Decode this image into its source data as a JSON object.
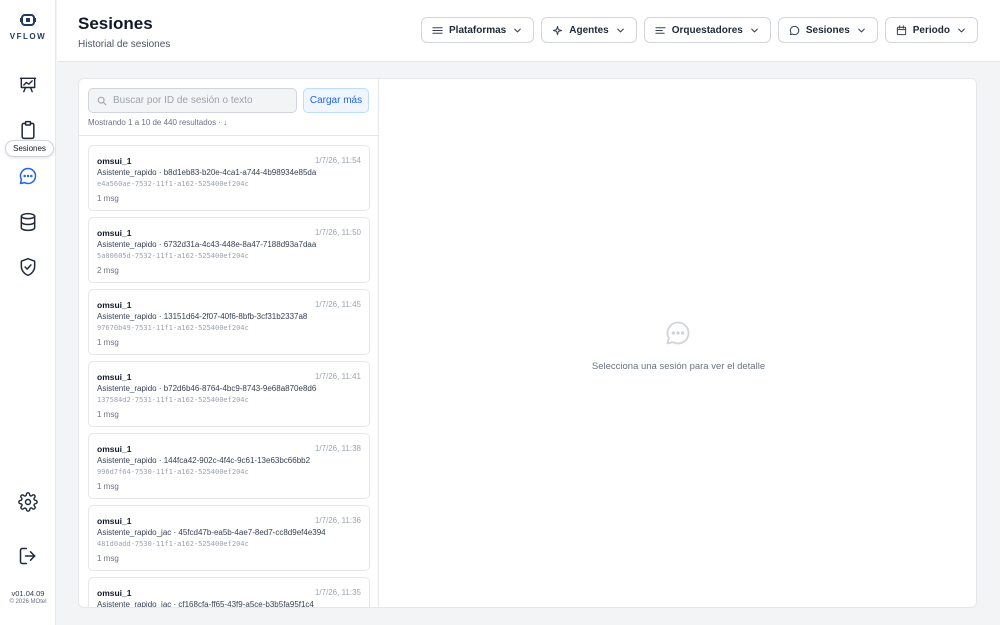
{
  "brand": {
    "logo_text": "VFLOW"
  },
  "sidebar": {
    "items": [
      {
        "name": "dashboard",
        "icon": "presentation-chart-icon"
      },
      {
        "name": "clipboard",
        "icon": "clipboard-icon"
      },
      {
        "name": "sesiones",
        "icon": "chat-bubble-icon",
        "active": true
      },
      {
        "name": "database",
        "icon": "database-icon"
      },
      {
        "name": "security",
        "icon": "shield-check-icon"
      }
    ],
    "tooltip": "Sesiones",
    "version": "v01.04.09",
    "copyright": "© 2026 MOtel"
  },
  "header": {
    "title": "Sesiones",
    "subtitle": "Historial de sesiones",
    "filters": [
      {
        "label": "Plataformas",
        "icon": "list-icon"
      },
      {
        "label": "Agentes",
        "icon": "sparkle-icon"
      },
      {
        "label": "Orquestadores",
        "icon": "lines-icon"
      },
      {
        "label": "Sesiones",
        "icon": "chat-bubble-icon"
      },
      {
        "label": "Periodo",
        "icon": "calendar-icon"
      }
    ]
  },
  "search": {
    "placeholder": "Buscar por ID de sesión o texto",
    "value": "",
    "load_more_label": "Cargar más",
    "results_text": "Mostrando 1 a 10 de 440 resultados · ↓"
  },
  "sessions": [
    {
      "user": "omsui_1",
      "time": "1/7/26, 11:54",
      "agent_line": "Asistente_rapido · b8d1eb83-b20e-4ca1-a744-4b98934e85da",
      "id": "e4a560ae-7532-11f1-a162-525400ef204c",
      "msgs": "1 msg"
    },
    {
      "user": "omsui_1",
      "time": "1/7/26, 11:50",
      "agent_line": "Asistente_rapido · 6732d31a-4c43-448e-8a47-7188d93a7daa",
      "id": "5a00605d-7532-11f1-a162-525400ef204c",
      "msgs": "2 msg"
    },
    {
      "user": "omsui_1",
      "time": "1/7/26, 11:45",
      "agent_line": "Asistente_rapido · 13151d64-2f07-40f6-8bfb-3cf31b2337a8",
      "id": "97670b49-7531-11f1-a162-525400ef204c",
      "msgs": "1 msg"
    },
    {
      "user": "omsui_1",
      "time": "1/7/26, 11:41",
      "agent_line": "Asistente_rapido · b72d6b46-8764-4bc9-8743-9e68a870e8d6",
      "id": "137584d2-7531-11f1-a162-525400ef204c",
      "msgs": "1 msg"
    },
    {
      "user": "omsui_1",
      "time": "1/7/26, 11:38",
      "agent_line": "Asistente_rapido · 144fca42-902c-4f4c-9c61-13e63bc66bb2",
      "id": "996d7f64-7530-11f1-a162-525400ef204c",
      "msgs": "1 msg"
    },
    {
      "user": "omsui_1",
      "time": "1/7/26, 11:36",
      "agent_line": "Asistente_rapido_jac · 45fcd47b-ea5b-4ae7-8ed7-cc8d9ef4e394",
      "id": "481d0add-7530-11f1-a162-525400ef204c",
      "msgs": "1 msg"
    },
    {
      "user": "omsui_1",
      "time": "1/7/26, 11:35",
      "agent_line": "Asistente_rapido_jac · cf168cfa-ff65-43f9-a5ce-b3b5fa95f1c4",
      "id": "",
      "msgs": ""
    }
  ],
  "detail": {
    "empty_text": "Selecciona una sesión para ver el detalle",
    "empty_icon": "chat-bubble-icon"
  },
  "colors": {
    "accent": "#2563eb",
    "text": "#111827",
    "muted": "#6b7280",
    "border": "#e5e7eb",
    "background": "#f3f4f6"
  }
}
